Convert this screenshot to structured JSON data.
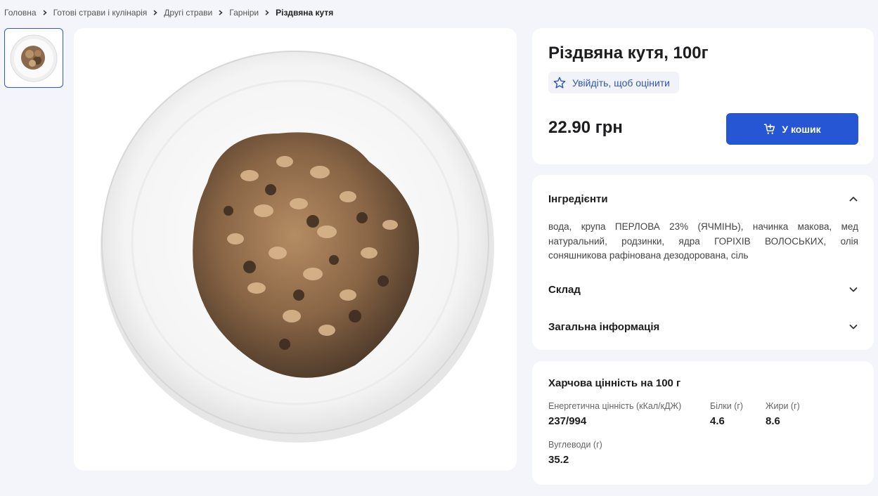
{
  "breadcrumb": {
    "items": [
      "Головна",
      "Готові страви і кулінарія",
      "Другі страви",
      "Гарніри"
    ],
    "current": "Різдвяна кутя"
  },
  "product": {
    "title": "Різдвяна кутя, 100г",
    "rating_prompt": "Увійдіть, щоб оцінити",
    "price": "22.90 грн",
    "add_to_cart": "У кошик"
  },
  "accordion": {
    "ingredients_title": "Інгредієнти",
    "ingredients_text": "вода, крупа ПЕРЛОВА 23% (ЯЧМІНЬ), начинка макова, мед натуральний, родзинки, ядра ГОРІХІВ ВОЛОСЬКИХ, олія соняшникова рафінована дезодорована, сіль",
    "composition_title": "Склад",
    "general_title": "Загальна інформація"
  },
  "nutrition": {
    "title": "Харчова цінність на 100 г",
    "energy_label": "Енергетична цінність (кКал/кДЖ)",
    "energy_value": "237/994",
    "protein_label": "Білки (г)",
    "protein_value": "4.6",
    "fat_label": "Жири (г)",
    "fat_value": "8.6",
    "carbs_label": "Вуглеводи (г)",
    "carbs_value": "35.2"
  },
  "colors": {
    "accent": "#2656d4",
    "link": "#2c56b8",
    "background": "#f4f5fa"
  },
  "icons": {
    "crumb_separator": "chevron-right-icon",
    "rating": "star-outline-icon",
    "cart": "cart-add-icon",
    "expanded": "chevron-up-icon",
    "collapsed": "chevron-down-icon"
  }
}
